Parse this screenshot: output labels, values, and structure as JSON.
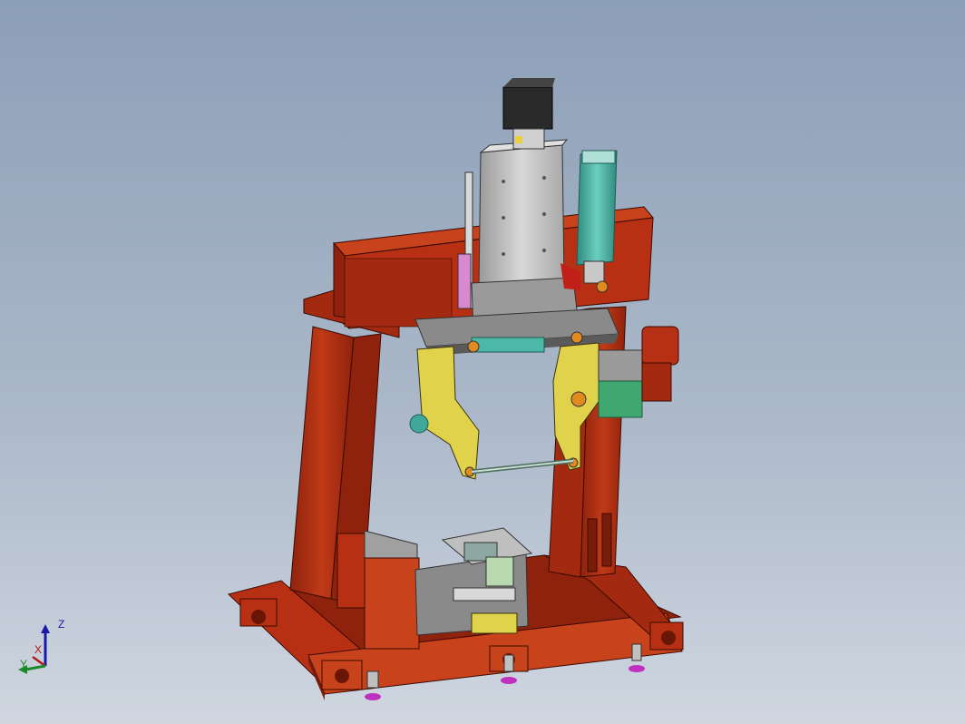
{
  "viewport": {
    "triad": {
      "z_label": "Z",
      "x_label": "X",
      "y_label": "Y",
      "z_color": "#1a1aa8",
      "x_color": "#b21a1a",
      "y_color": "#1a8a2a"
    }
  },
  "colors": {
    "background_top": "#8c9fb8",
    "background_bottom": "#cfd6e0",
    "frame_red": "#b83014",
    "frame_red_dark": "#7a1c0a",
    "arm_yellow": "#e0d24a",
    "cylinder_teal": "#3fa89a",
    "motor_black": "#2a2a2a",
    "slide_grey": "#bfbfbf"
  }
}
